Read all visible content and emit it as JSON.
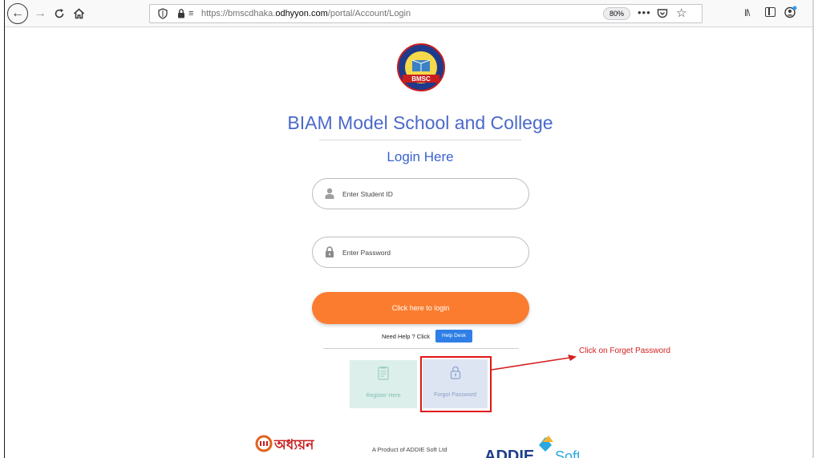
{
  "browser": {
    "url_prefix": "https://bmscdhaka.",
    "url_domain": "odhyyon.com",
    "url_path": "/portal/Account/Login",
    "zoom": "80%",
    "page_actions": "•••"
  },
  "page": {
    "school_name": "BIAM Model School and College",
    "login_heading": "Login Here",
    "logo_text": "BMSC",
    "student_id_placeholder": "Enter Student ID",
    "password_placeholder": "Enter Password",
    "login_button": "Click here to login",
    "need_help_text": "Need Help ? Click",
    "help_desk_button": "Help Desk",
    "register_label": "Register Here",
    "forgot_label": "Forgot Password"
  },
  "annotation": {
    "text": "Click on Forget Password",
    "color": "#d42020"
  },
  "footer": {
    "product_text": "A Product of ADDIE Soft Ltd",
    "left_logo_text": "অধ্যয়ন",
    "right_logo_text": "ADDIE",
    "right_logo_suffix": "Soft"
  },
  "colors": {
    "title_blue": "#4b69c9",
    "login_orange": "#fb7c2e",
    "help_blue": "#2f7fe6"
  },
  "icons": [
    "back-icon",
    "forward-icon",
    "reload-icon",
    "home-icon",
    "shield-icon",
    "lock-icon",
    "permissions-icon",
    "pocket-icon",
    "bookmark-star-icon",
    "library-icon",
    "sidebar-icon",
    "account-icon",
    "user-icon",
    "password-lock-icon",
    "register-icon",
    "forgot-lock-icon"
  ]
}
